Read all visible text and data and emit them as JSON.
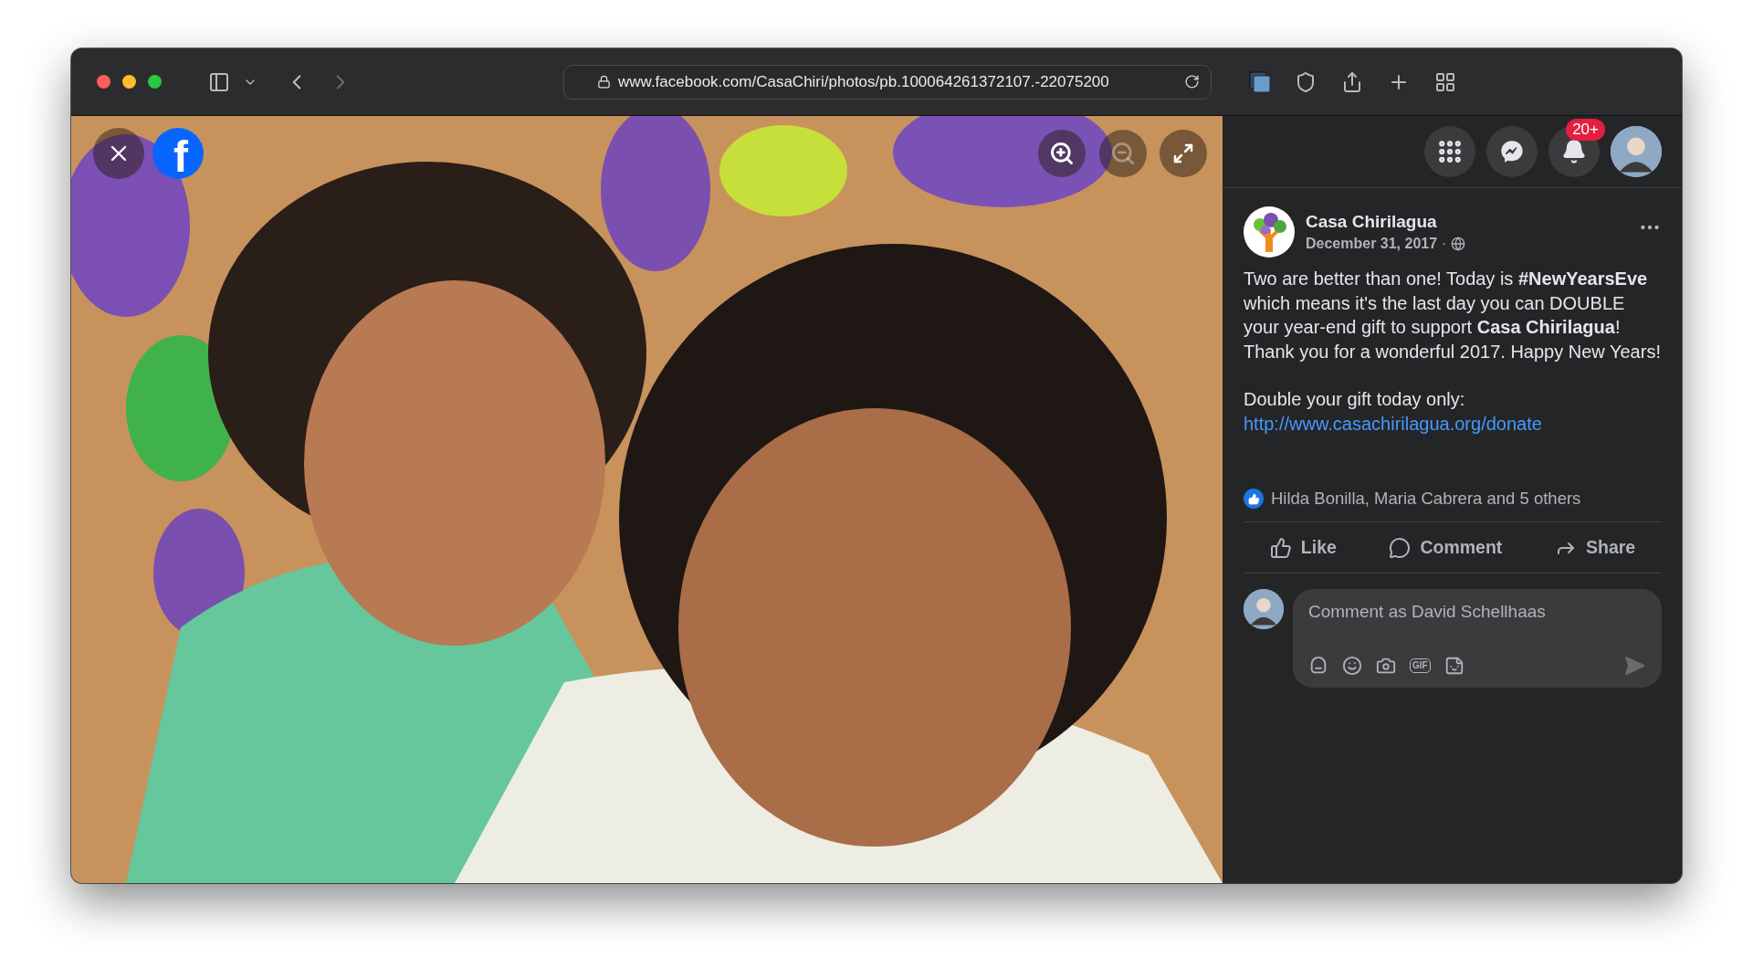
{
  "browser": {
    "url": "www.facebook.com/CasaChiri/photos/pb.100064261372107.-22075200"
  },
  "logo": "f",
  "viewer_controls": [
    {
      "kind": "zoom-in",
      "disabled": false
    },
    {
      "kind": "zoom-out",
      "disabled": true
    },
    {
      "kind": "fullscreen",
      "disabled": false
    }
  ],
  "topbar": {
    "notifications_badge": "20+"
  },
  "post": {
    "author": "Casa Chirilagua",
    "date": "December 31, 2017",
    "separator": "·",
    "text": "Two are better than one! Today is **#NewYearsEve** which means it's the last day you can DOUBLE your year-end gift to support **Casa Chirilagua**! Thank you for a wonderful 2017. Happy New Years!",
    "cta": "Double your gift today only:",
    "link": "http://www.casachirilagua.org/donate",
    "reactions": "Hilda Bonilla, Maria Cabrera and 5 others",
    "actions": [
      {
        "kind": "like",
        "label": "Like"
      },
      {
        "kind": "comment",
        "label": "Comment"
      },
      {
        "kind": "share",
        "label": "Share"
      }
    ]
  },
  "composer": {
    "placeholder": "Comment as David Schellhaas",
    "tools": [
      {
        "kind": "avatar-sticker"
      },
      {
        "kind": "emoji"
      },
      {
        "kind": "camera"
      },
      {
        "kind": "gif",
        "label": "GIF"
      },
      {
        "kind": "sticker"
      }
    ]
  }
}
